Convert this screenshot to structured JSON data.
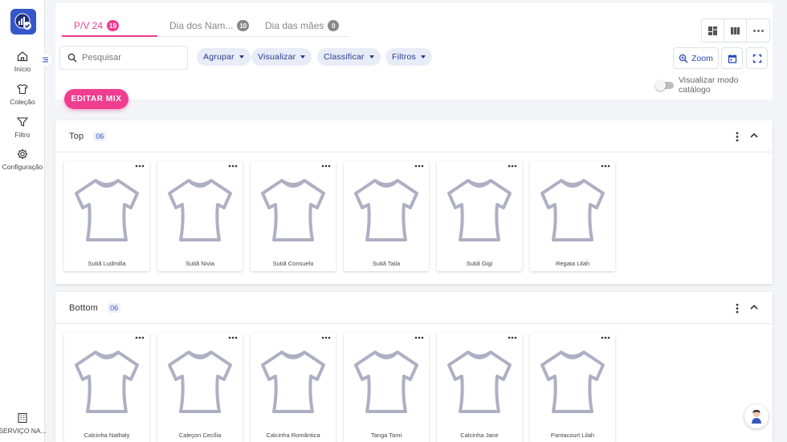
{
  "sidebar": {
    "items": [
      {
        "label": "Início",
        "icon": "home-icon"
      },
      {
        "label": "Coleção",
        "icon": "shirt-icon"
      },
      {
        "label": "Filtro",
        "icon": "filter-icon"
      },
      {
        "label": "Configuração",
        "icon": "gear-icon"
      }
    ],
    "footer_label": "SERVIÇO NA..."
  },
  "tabs": [
    {
      "label": "P/V 24",
      "count": "19"
    },
    {
      "label": "Dia dos Nam...",
      "count": "10"
    },
    {
      "label": "Dia das mães",
      "count": "0"
    }
  ],
  "search": {
    "placeholder": "Pesquisar"
  },
  "toolbar": {
    "chips": [
      "Agrupar",
      "Visualizar",
      "Classificar",
      "Filtros"
    ],
    "zoom_label": "Zoom",
    "catalog_toggle_label": "Visualizar modo catálogo",
    "edit_mix_label": "EDITAR MIX"
  },
  "sections": [
    {
      "title": "Top",
      "count": "06",
      "products": [
        "Sutiã Ludmilla",
        "Sutiã Nivia",
        "Sutiã Consuelo",
        "Sutiã Taila",
        "Sutiã Gigi",
        "Regata Lilah"
      ]
    },
    {
      "title": "Bottom",
      "count": "06",
      "products": [
        "Calcinha Nathaly",
        "Caleçon Cecília",
        "Calcinha Romântica",
        "Tanga Tami",
        "Calcinha Jane",
        "Pantacourt Lilah"
      ]
    }
  ],
  "colors": {
    "accent": "#ef3d8f",
    "primary": "#2a47b8",
    "chip_bg": "#e8ecf7"
  }
}
